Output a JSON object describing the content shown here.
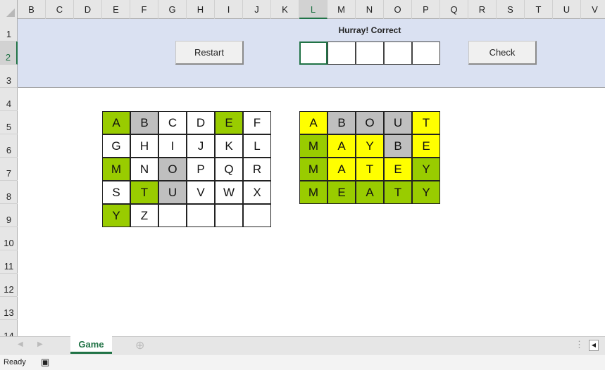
{
  "columns": [
    "B",
    "C",
    "D",
    "E",
    "F",
    "G",
    "H",
    "I",
    "J",
    "K",
    "L",
    "M",
    "N",
    "O",
    "P",
    "Q",
    "R",
    "S",
    "T",
    "U",
    "V"
  ],
  "selected_column": "L",
  "rows": [
    "1",
    "2",
    "3",
    "4",
    "5",
    "6",
    "7",
    "8",
    "9",
    "10",
    "11",
    "12",
    "13",
    "14"
  ],
  "selected_row": "2",
  "header": {
    "message": "Hurray! Correct",
    "restart_label": "Restart",
    "check_label": "Check"
  },
  "colors": {
    "green": "#99cc00",
    "yellow": "#ffff00",
    "gray": "#bfbfbf",
    "band": "#dae1f2"
  },
  "keyboard": [
    [
      {
        "l": "A",
        "s": "green"
      },
      {
        "l": "B",
        "s": "gray"
      },
      {
        "l": "C",
        "s": "none"
      },
      {
        "l": "D",
        "s": "none"
      },
      {
        "l": "E",
        "s": "green"
      },
      {
        "l": "F",
        "s": "none"
      }
    ],
    [
      {
        "l": "G",
        "s": "none"
      },
      {
        "l": "H",
        "s": "none"
      },
      {
        "l": "I",
        "s": "none"
      },
      {
        "l": "J",
        "s": "none"
      },
      {
        "l": "K",
        "s": "none"
      },
      {
        "l": "L",
        "s": "none"
      }
    ],
    [
      {
        "l": "M",
        "s": "green"
      },
      {
        "l": "N",
        "s": "none"
      },
      {
        "l": "O",
        "s": "gray"
      },
      {
        "l": "P",
        "s": "none"
      },
      {
        "l": "Q",
        "s": "none"
      },
      {
        "l": "R",
        "s": "none"
      }
    ],
    [
      {
        "l": "S",
        "s": "none"
      },
      {
        "l": "T",
        "s": "green"
      },
      {
        "l": "U",
        "s": "gray"
      },
      {
        "l": "V",
        "s": "none"
      },
      {
        "l": "W",
        "s": "none"
      },
      {
        "l": "X",
        "s": "none"
      }
    ],
    [
      {
        "l": "Y",
        "s": "green"
      },
      {
        "l": "Z",
        "s": "none"
      },
      {
        "l": "",
        "s": "none"
      },
      {
        "l": "",
        "s": "none"
      },
      {
        "l": "",
        "s": "none"
      },
      {
        "l": "",
        "s": "none"
      }
    ]
  ],
  "guesses": [
    [
      {
        "l": "A",
        "s": "yellow"
      },
      {
        "l": "B",
        "s": "gray"
      },
      {
        "l": "O",
        "s": "gray"
      },
      {
        "l": "U",
        "s": "gray"
      },
      {
        "l": "T",
        "s": "yellow"
      }
    ],
    [
      {
        "l": "M",
        "s": "green"
      },
      {
        "l": "A",
        "s": "yellow"
      },
      {
        "l": "Y",
        "s": "yellow"
      },
      {
        "l": "B",
        "s": "gray"
      },
      {
        "l": "E",
        "s": "yellow"
      }
    ],
    [
      {
        "l": "M",
        "s": "green"
      },
      {
        "l": "A",
        "s": "yellow"
      },
      {
        "l": "T",
        "s": "yellow"
      },
      {
        "l": "E",
        "s": "yellow"
      },
      {
        "l": "Y",
        "s": "green"
      }
    ],
    [
      {
        "l": "M",
        "s": "green"
      },
      {
        "l": "E",
        "s": "green"
      },
      {
        "l": "A",
        "s": "green"
      },
      {
        "l": "T",
        "s": "green"
      },
      {
        "l": "Y",
        "s": "green"
      }
    ]
  ],
  "sheet_tab": "Game",
  "status": "Ready"
}
